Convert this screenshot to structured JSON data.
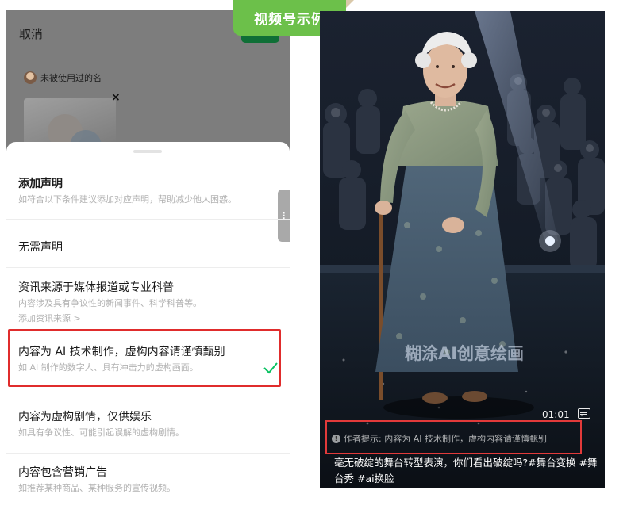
{
  "badge": {
    "label": "视频号示例"
  },
  "left_panel": {
    "header": {
      "cancel_label": "取消"
    },
    "author_name": "未被使用过的名",
    "sheet": {
      "options": [
        {
          "title": "添加声明",
          "subtitle": "如符合以下条件建议添加对应声明，帮助减少他人困惑。"
        },
        {
          "title": "无需声明",
          "subtitle": ""
        },
        {
          "title": "资讯来源于媒体报道或专业科普",
          "subtitle": "内容涉及具有争议性的新闻事件、科学科普等。",
          "link": "添加资讯来源 >"
        },
        {
          "title": "内容为 AI 技术制作，虚构内容请谨慎甄别",
          "subtitle": "如 AI 制作的数字人、具有冲击力的虚构画面。",
          "selected": true
        },
        {
          "title": "内容为虚构剧情，仅供娱乐",
          "subtitle": "如具有争议性、可能引起误解的虚构剧情。"
        },
        {
          "title": "内容包含营销广告",
          "subtitle": "如推荐某种商品、某种服务的宣传视频。"
        }
      ]
    },
    "colors": {
      "check": "#07c160",
      "highlight": "#e02c2c"
    }
  },
  "video": {
    "watermark": "糊涂AI创意绘画",
    "time": "01:01",
    "notice": "作者提示: 内容为 AI 技术制作，虚构内容请谨慎甄别",
    "caption": "毫无破绽的舞台转型表演，你们看出破绽吗?#舞台变换 #舞台秀 #ai换脸"
  }
}
